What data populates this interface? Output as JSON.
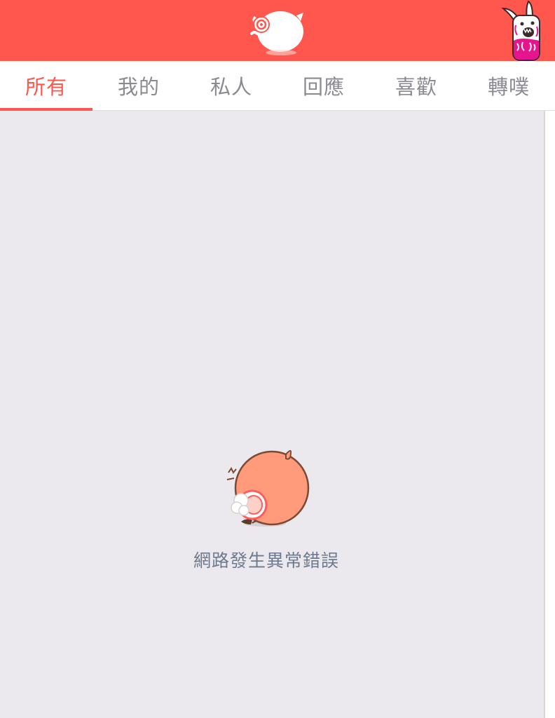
{
  "header": {
    "logo_icon": "pig-mascot-logo-icon",
    "avatar_icon": "screaming-monster-avatar-icon",
    "background_color": "#ff574d"
  },
  "tabs": [
    {
      "label": "所有",
      "active": true
    },
    {
      "label": "我的",
      "active": false
    },
    {
      "label": "私人",
      "active": false
    },
    {
      "label": "回應",
      "active": false
    },
    {
      "label": "喜歡",
      "active": false
    },
    {
      "label": "轉噗",
      "active": false
    }
  ],
  "main": {
    "error_icon": "fallen-pig-mascot-icon",
    "error_message": "網路發生異常錯誤"
  }
}
